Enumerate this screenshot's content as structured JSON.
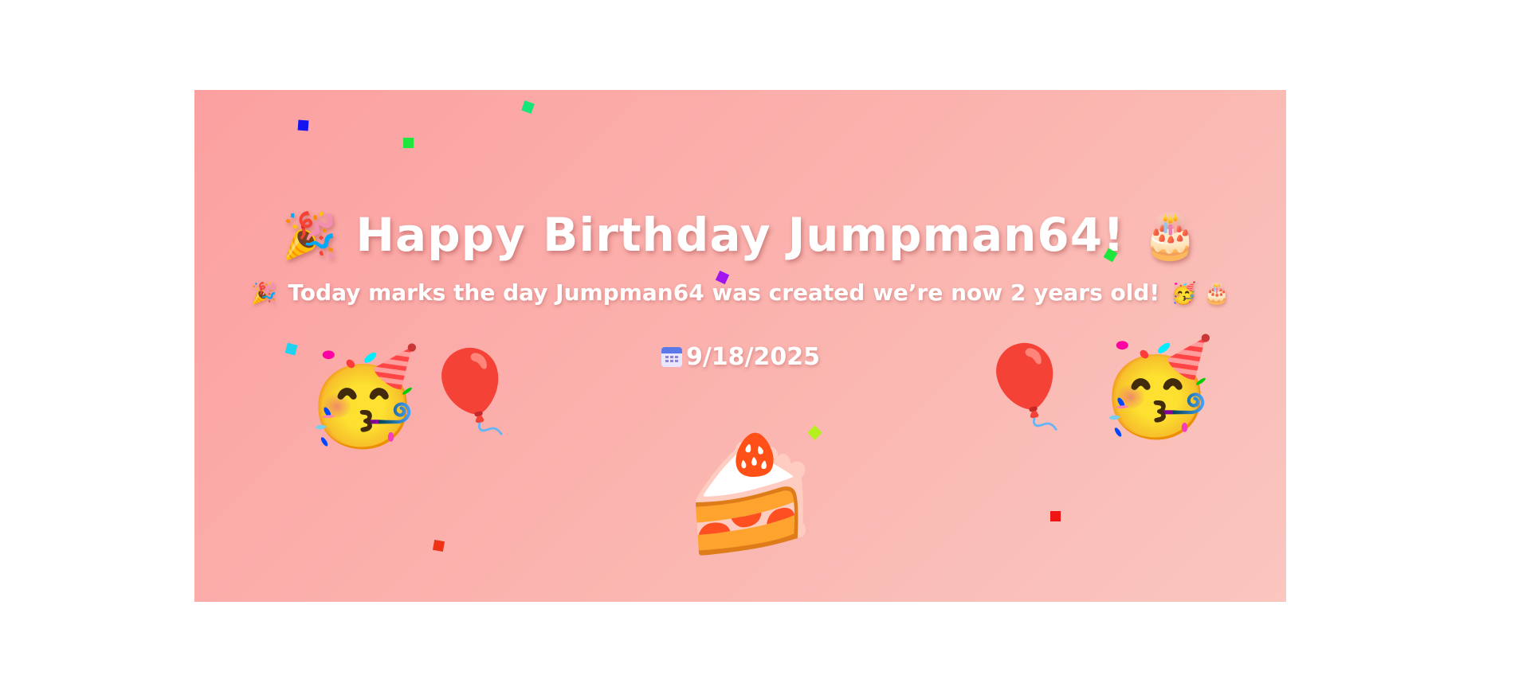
{
  "banner": {
    "title": "Happy Birthday Jumpman64!",
    "title_emoji_left": "🎉",
    "title_emoji_right": "🎂",
    "subtitle": "Today marks the day Jumpman64 was created we’re now 2 years old!",
    "subtitle_emoji_left": "🎉",
    "subtitle_emoji_right": "🥳 🎂",
    "date": "9/18/2025",
    "background_colors": [
      "#fba0a0",
      "#fac6bf"
    ]
  },
  "decorations": {
    "left_face": "🥳",
    "left_balloon": "🎈",
    "center_cake": "🍰",
    "right_balloon": "🎈",
    "right_face": "🥳"
  },
  "confetti_colors": [
    "#1414f0",
    "#1ee63c",
    "#14e678",
    "#a014f0",
    "#1ed2f0",
    "#b4f01e",
    "#f03214",
    "#f01414"
  ]
}
